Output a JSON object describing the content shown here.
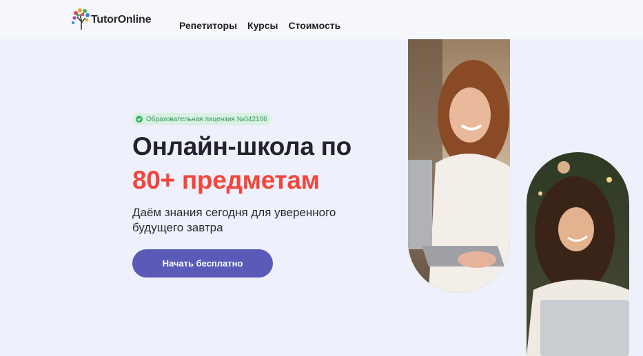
{
  "header": {
    "logo_text": "TutorOnline",
    "nav": [
      "Репетиторы",
      "Курсы",
      "Стоимость"
    ]
  },
  "hero": {
    "badge": "Образовательная лицензия №042106",
    "title_line1": "Онлайн-школа по",
    "title_line2": "80+ предметам",
    "subtitle": "Даём знания сегодня для уверенного будущего завтра",
    "cta": "Начать бесплатно"
  },
  "colors": {
    "accent": "#f2463b",
    "button": "#5b5ab8",
    "badge_green": "#2db563",
    "background": "#eef0fb"
  },
  "images": [
    "woman-with-laptop-photo",
    "girl-laughing-at-laptop-photo"
  ]
}
